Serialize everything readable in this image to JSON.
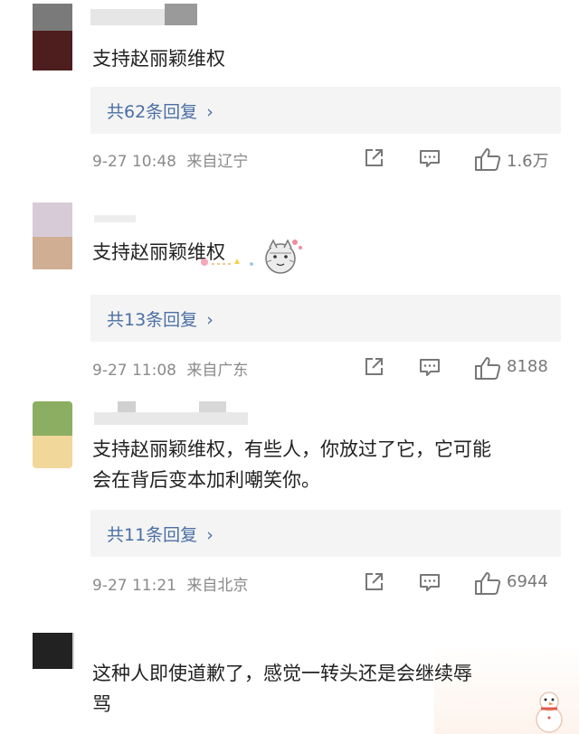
{
  "comments": [
    {
      "text": "支持赵丽颖维权",
      "reply_label": "共62条回复",
      "timestamp": "9-27 10:48",
      "location": "来自辽宁",
      "likes": "1.6万"
    },
    {
      "text": "支持赵丽颖维权",
      "reply_label": "共13条回复",
      "timestamp": "9-27 11:08",
      "location": "来自广东",
      "likes": "8188"
    },
    {
      "text_line1": "支持赵丽颖维权，有些人，你放过了它，它可能",
      "text_line2": "会在背后变本加利嘲笑你。",
      "reply_label": "共11条回复",
      "timestamp": "9-27 11:21",
      "location": "来自北京",
      "likes": "6944"
    },
    {
      "text_line1": "这种人即使道歉了，感觉一转头还是会继续辱",
      "text_line2": "骂"
    }
  ],
  "icons": {
    "share": "share-icon",
    "comment": "comment-icon",
    "like": "thumbs-up-icon",
    "chevron": "chevron-right-icon"
  },
  "colors": {
    "reply_link": "#4a6fa5",
    "reply_bg": "#f4f4f4",
    "meta": "#8a8a8a"
  }
}
